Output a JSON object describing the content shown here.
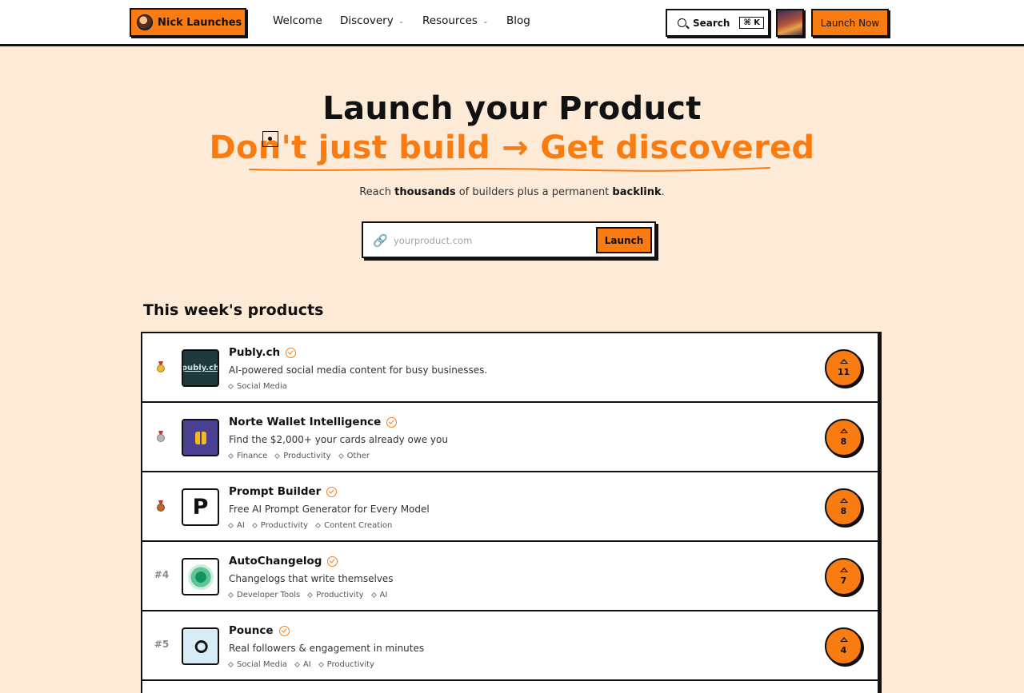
{
  "header": {
    "logo_label": "Nick Launches",
    "nav": {
      "welcome": "Welcome",
      "discovery": "Discovery",
      "resources": "Resources",
      "blog": "Blog"
    },
    "search_label": "Search",
    "search_shortcut": "⌘ K",
    "launch_now": "Launch Now"
  },
  "hero": {
    "title": "Launch your Product",
    "subtitle": "Don't just build → Get discovered",
    "tagline_pre": "Reach ",
    "tagline_bold1": "thousands",
    "tagline_mid": " of builders plus a permanent ",
    "tagline_bold2": "backlink",
    "tagline_end": ".",
    "url_placeholder": "yourproduct.com",
    "launch_button": "Launch"
  },
  "colors": {
    "accent": "#f97c12",
    "background": "#fdebd7",
    "border": "#111111"
  },
  "products": {
    "section_title": "This week's products",
    "items": [
      {
        "rank": "",
        "medal": "gold",
        "name": "Publy.ch",
        "logo_text": "publy.ch",
        "description": "AI-powered social media content for busy businesses.",
        "tags": [
          "Social Media"
        ],
        "votes": "11"
      },
      {
        "rank": "",
        "medal": "silver",
        "name": "Norte Wallet Intelligence",
        "logo_text": "",
        "description": "Find the $2,000+ your cards already owe you",
        "tags": [
          "Finance",
          "Productivity",
          "Other"
        ],
        "votes": "8"
      },
      {
        "rank": "",
        "medal": "bronze",
        "name": "Prompt Builder",
        "logo_text": "P",
        "description": "Free AI Prompt Generator for Every Model",
        "tags": [
          "AI",
          "Productivity",
          "Content Creation"
        ],
        "votes": "8"
      },
      {
        "rank": "#4",
        "medal": "",
        "name": "AutoChangelog",
        "logo_text": "",
        "description": "Changelogs that write themselves",
        "tags": [
          "Developer Tools",
          "Productivity",
          "AI"
        ],
        "votes": "7"
      },
      {
        "rank": "#5",
        "medal": "",
        "name": "Pounce",
        "logo_text": "ഠ",
        "description": "Real followers & engagement in minutes",
        "tags": [
          "Social Media",
          "AI",
          "Productivity"
        ],
        "votes": "4"
      }
    ]
  }
}
